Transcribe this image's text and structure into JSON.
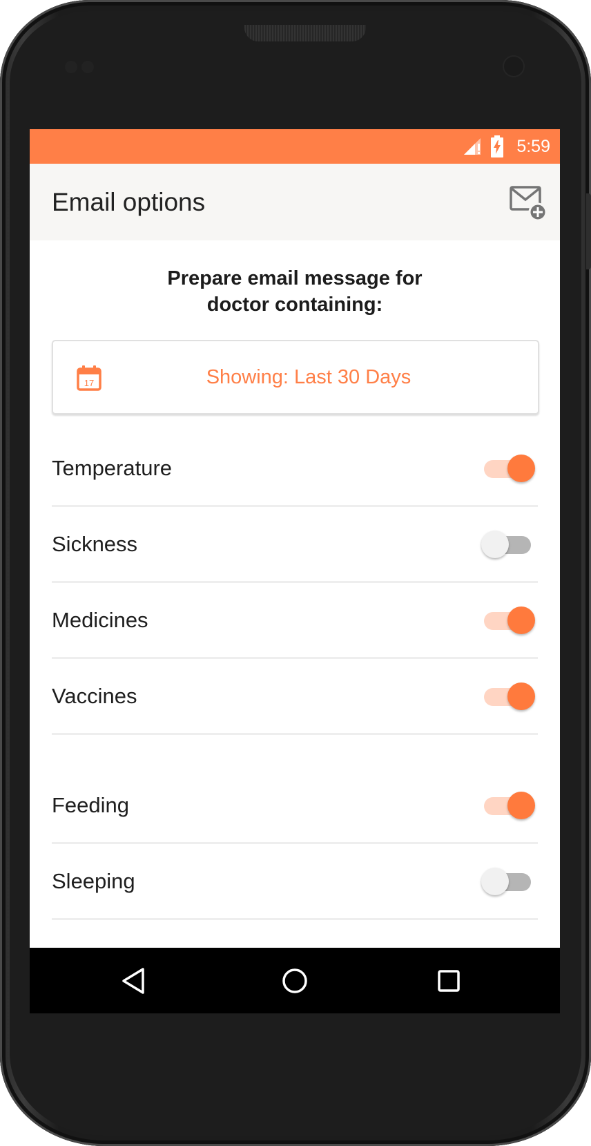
{
  "status_bar": {
    "time": "5:59",
    "background": "#ff7f47",
    "icons": [
      "signal-icon",
      "battery-charging-icon"
    ]
  },
  "app_bar": {
    "title": "Email options",
    "action_icon": "email-add-icon"
  },
  "intro": {
    "line1": "Prepare email message for",
    "line2": "doctor containing:"
  },
  "date_range": {
    "icon": "calendar-icon",
    "calendar_day": "17",
    "label": "Showing: Last 30 Days"
  },
  "options": [
    {
      "label": "Temperature",
      "enabled": true
    },
    {
      "label": "Sickness",
      "enabled": false
    },
    {
      "label": "Medicines",
      "enabled": true
    },
    {
      "label": "Vaccines",
      "enabled": true
    },
    {
      "label": "Feeding",
      "enabled": true
    },
    {
      "label": "Sleeping",
      "enabled": false
    }
  ],
  "nav_bar": {
    "buttons": [
      "back-icon",
      "home-icon",
      "recents-icon"
    ]
  },
  "colors": {
    "accent": "#ff7f47",
    "toggle_on_track": "#ffd5c3",
    "toggle_off_track": "#b5b5b5",
    "app_bar": "#f7f6f4"
  }
}
